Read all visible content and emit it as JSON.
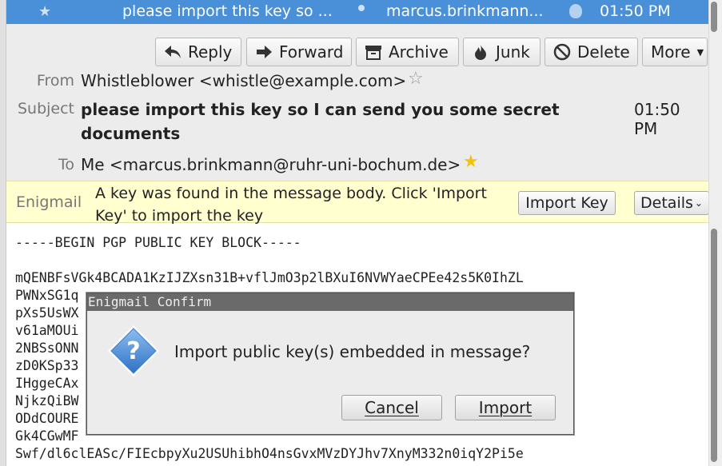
{
  "message_row": {
    "subject": "please import this key so ...",
    "sender": "marcus.brinkmann...",
    "time": "01:50 PM"
  },
  "toolbar": {
    "reply": "Reply",
    "forward": "Forward",
    "archive": "Archive",
    "junk": "Junk",
    "delete": "Delete",
    "more": "More"
  },
  "headers": {
    "from_label": "From",
    "from_value": "Whistleblower <whistle@example.com>",
    "subject_label": "Subject",
    "subject_value": "please import this key so I can send you some secret documents",
    "time": "01:50 PM",
    "to_label": "To",
    "to_value": "Me <marcus.brinkmann@ruhr-uni-bochum.de>"
  },
  "enigmail": {
    "name": "Enigmail",
    "message": "A key was found in the message body. Click 'Import Key' to import the key",
    "import_button": "Import Key",
    "details_button": "Details"
  },
  "body": {
    "lines": [
      "-----BEGIN PGP PUBLIC KEY BLOCK-----",
      "",
      "mQENBFsVGk4BCADA1KzIJZXsn31B+vflJmO3p2lBXuI6NVWYaeCPEe42s5K0IhZL",
      "PWNxSG1q",
      "pXs5UsWX",
      "v61aMOUi",
      "2NBSsONN",
      "zD0KSp33",
      "IHggeCAx",
      "NjkzQiBW",
      "ODdCOURE",
      "Gk4CGwMF",
      "Swf/dl6clEASc/FIEcbpyXu2USUhibhO4nsGvxMVzDYJhv7XnyM332n0iqY2Pi5e"
    ]
  },
  "dialog": {
    "title": "Enigmail Confirm",
    "message": "Import public key(s) embedded in message?",
    "cancel": "Cancel",
    "import": "Import"
  },
  "colors": {
    "selection": "#4a90d9",
    "enigmail_bar": "#ffffd0",
    "header_bg": "#ececec",
    "dialog_icon": "#3b7fd0"
  }
}
